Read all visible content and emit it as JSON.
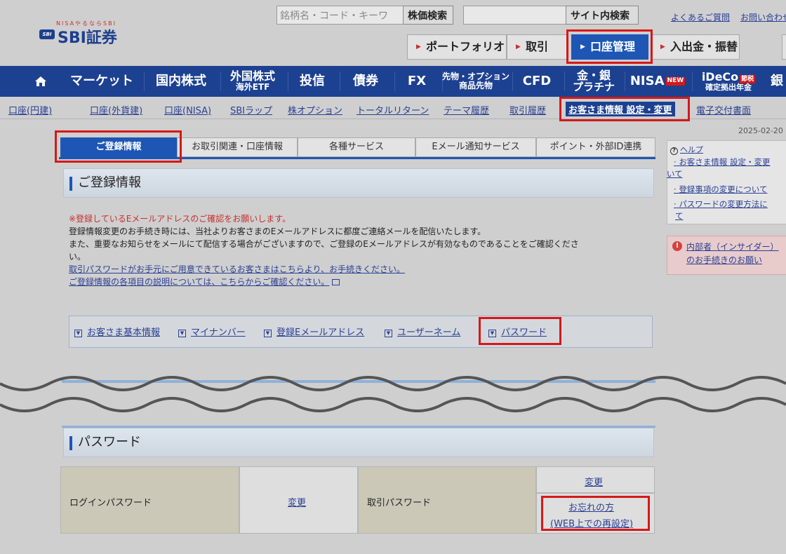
{
  "header": {
    "logo_small": "NISAやるならSBI",
    "logo_badge": "SBI",
    "logo_text": "SBI証券",
    "stock_search_placeholder": "銘柄名・コード・キーワ",
    "stock_search_button": "株価検索",
    "site_search_button": "サイト内検索",
    "faq_link": "よくあるご質問",
    "contact_link": "お問い合わせ",
    "nav_buttons": [
      "ポートフォリオ",
      "取引",
      "口座管理",
      "入出金・振替"
    ]
  },
  "main_nav": [
    {
      "label": "マーケット"
    },
    {
      "label": "国内株式"
    },
    {
      "label": "外国株式",
      "sub": "海外ETF"
    },
    {
      "label": "投信"
    },
    {
      "label": "債券"
    },
    {
      "label": "FX"
    },
    {
      "label": "先物・オプション",
      "sub": "商品先物"
    },
    {
      "label": "CFD"
    },
    {
      "label": "金・銀",
      "sub": "プラチナ"
    },
    {
      "label": "NISA",
      "badge": "NEW"
    },
    {
      "label": "iDeCo",
      "badge": "節税",
      "sub": "確定拠出年金"
    },
    {
      "label": "銀"
    }
  ],
  "sub_nav": [
    "口座(円建)",
    "口座(外貨建)",
    "口座(NISA)",
    "SBIラップ",
    "株オプション",
    "トータルリターン",
    "テーマ履歴",
    "取引履歴",
    "お客さま情報 設定・変更",
    "電子交付書面"
  ],
  "date_text": "2025-02-20 1",
  "tabs": [
    "ご登録情報",
    "お取引関連・口座情報",
    "各種サービス",
    "Eメール通知サービス",
    "ポイント・外部ID連携"
  ],
  "section1": {
    "title": "ご登録情報",
    "notice_red": "※登録しているEメールアドレスのご確認をお願いします。",
    "notice_1": "登録情報変更のお手続き時には、当社よりお客さまのEメールアドレスに都度ご連絡メールを配信いたします。",
    "notice_2": "また、重要なお知らせをメールにて配信する場合がございますので、ご登録のEメールアドレスが有効なものであることをご確認くださ",
    "notice_3": "い。",
    "link_1": "取引パスワードがお手元にご用意できているお客さまはこちらより、お手続きください。",
    "link_2": "ご登録情報の各項目の説明については、こちらからご確認ください。",
    "anchors": [
      "お客さま基本情報",
      "マイナンバー",
      "登録Eメールアドレス",
      "ユーザーネーム",
      "パスワード"
    ]
  },
  "help": {
    "title": "ヘルプ",
    "items": [
      "お客さま情報 設定・変更",
      "いて",
      "登録事項の変更について",
      "パスワードの変更方法に",
      "て"
    ],
    "insider_1": "内部者（インサイダー）",
    "insider_2": "のお手続きのお願い"
  },
  "section2": {
    "title": "パスワード",
    "login_label": "ログインパスワード",
    "login_change": "変更",
    "trade_label": "取引パスワード",
    "trade_change": "変更",
    "forgot_1": "お忘れの方",
    "forgot_2": "(WEB上での再設定)"
  }
}
